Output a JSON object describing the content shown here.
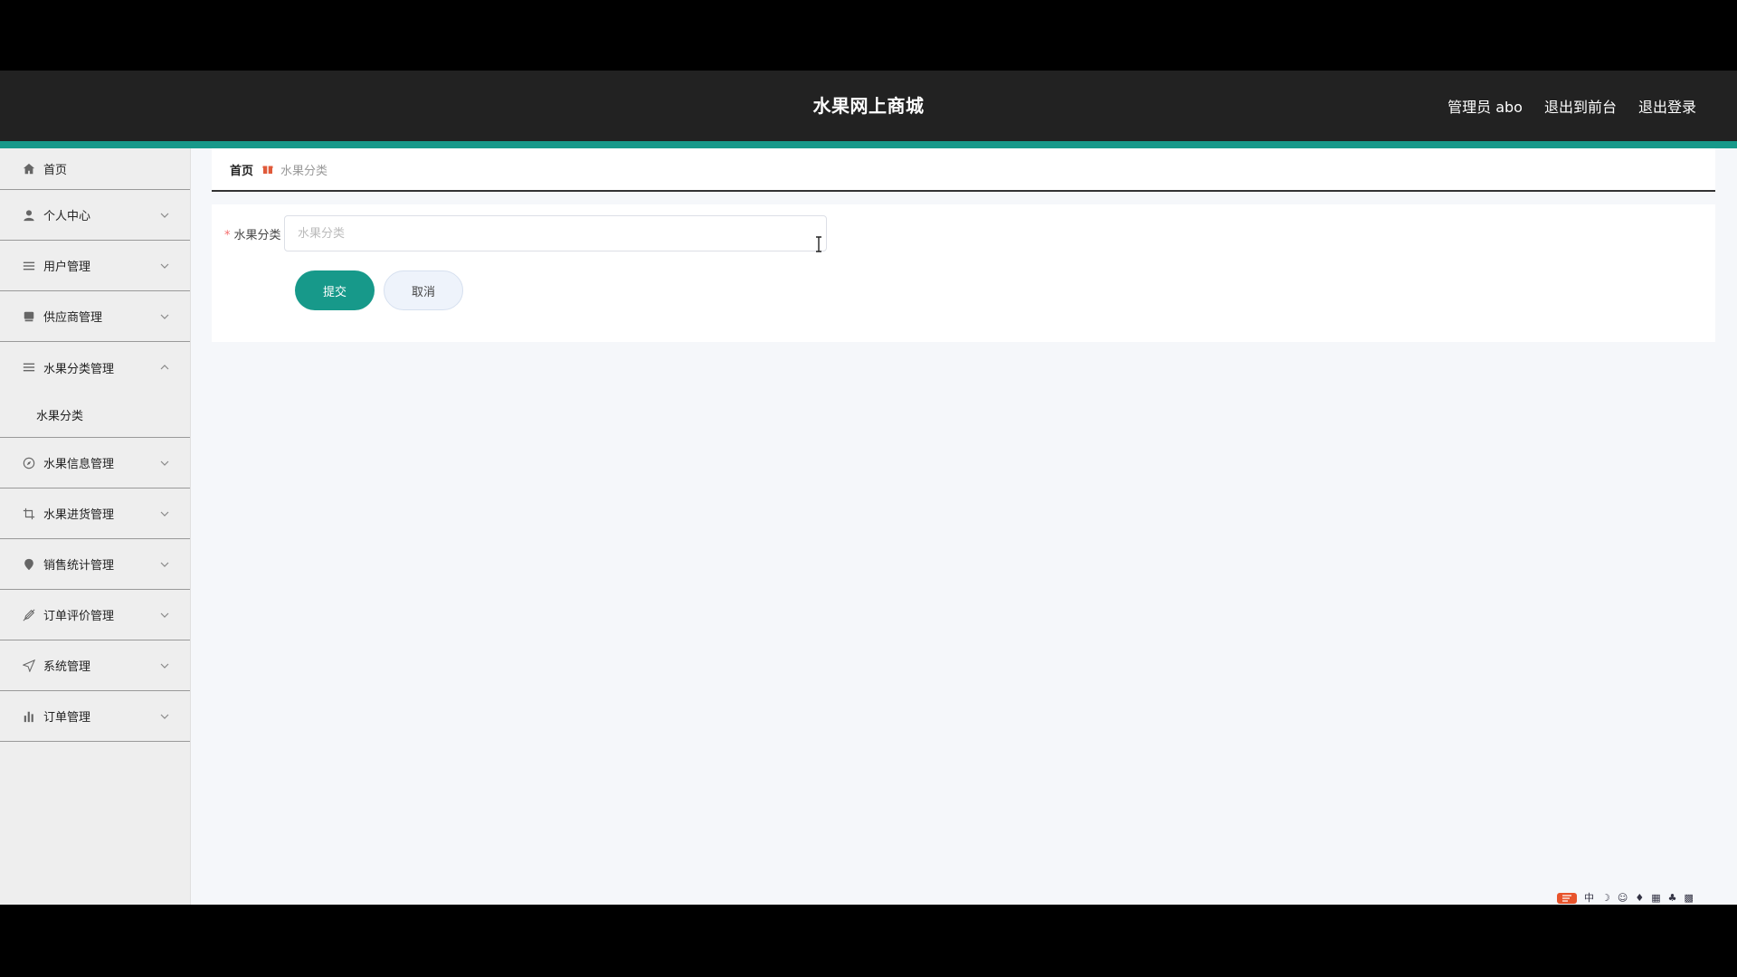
{
  "header": {
    "title": "水果网上商城",
    "admin": "管理员 abo",
    "exit_front": "退出到前台",
    "logout": "退出登录"
  },
  "colors": {
    "header_bg": "#222222",
    "accent": "#17998a",
    "sidebar_bg": "#eeeeee",
    "danger": "#f56c6c"
  },
  "sidebar": {
    "items": [
      {
        "label": "首页",
        "icon": "home-icon"
      },
      {
        "label": "个人中心",
        "icon": "user-icon"
      },
      {
        "label": "用户管理",
        "icon": "list-icon"
      },
      {
        "label": "供应商管理",
        "icon": "store-icon"
      },
      {
        "label": "水果分类管理",
        "icon": "list-icon",
        "expanded": true,
        "children": [
          "水果分类"
        ]
      },
      {
        "label": "水果信息管理",
        "icon": "compass-icon"
      },
      {
        "label": "水果进货管理",
        "icon": "crop-icon"
      },
      {
        "label": "销售统计管理",
        "icon": "location-icon"
      },
      {
        "label": "订单评价管理",
        "icon": "edit-off-icon"
      },
      {
        "label": "系统管理",
        "icon": "send-icon"
      },
      {
        "label": "订单管理",
        "icon": "bar-chart-icon"
      }
    ]
  },
  "breadcrumb": {
    "home": "首页",
    "current": "水果分类"
  },
  "form": {
    "label": "水果分类",
    "placeholder": "水果分类",
    "value": "",
    "submit": "提交",
    "cancel": "取消"
  },
  "tray": {
    "ime": "中"
  }
}
